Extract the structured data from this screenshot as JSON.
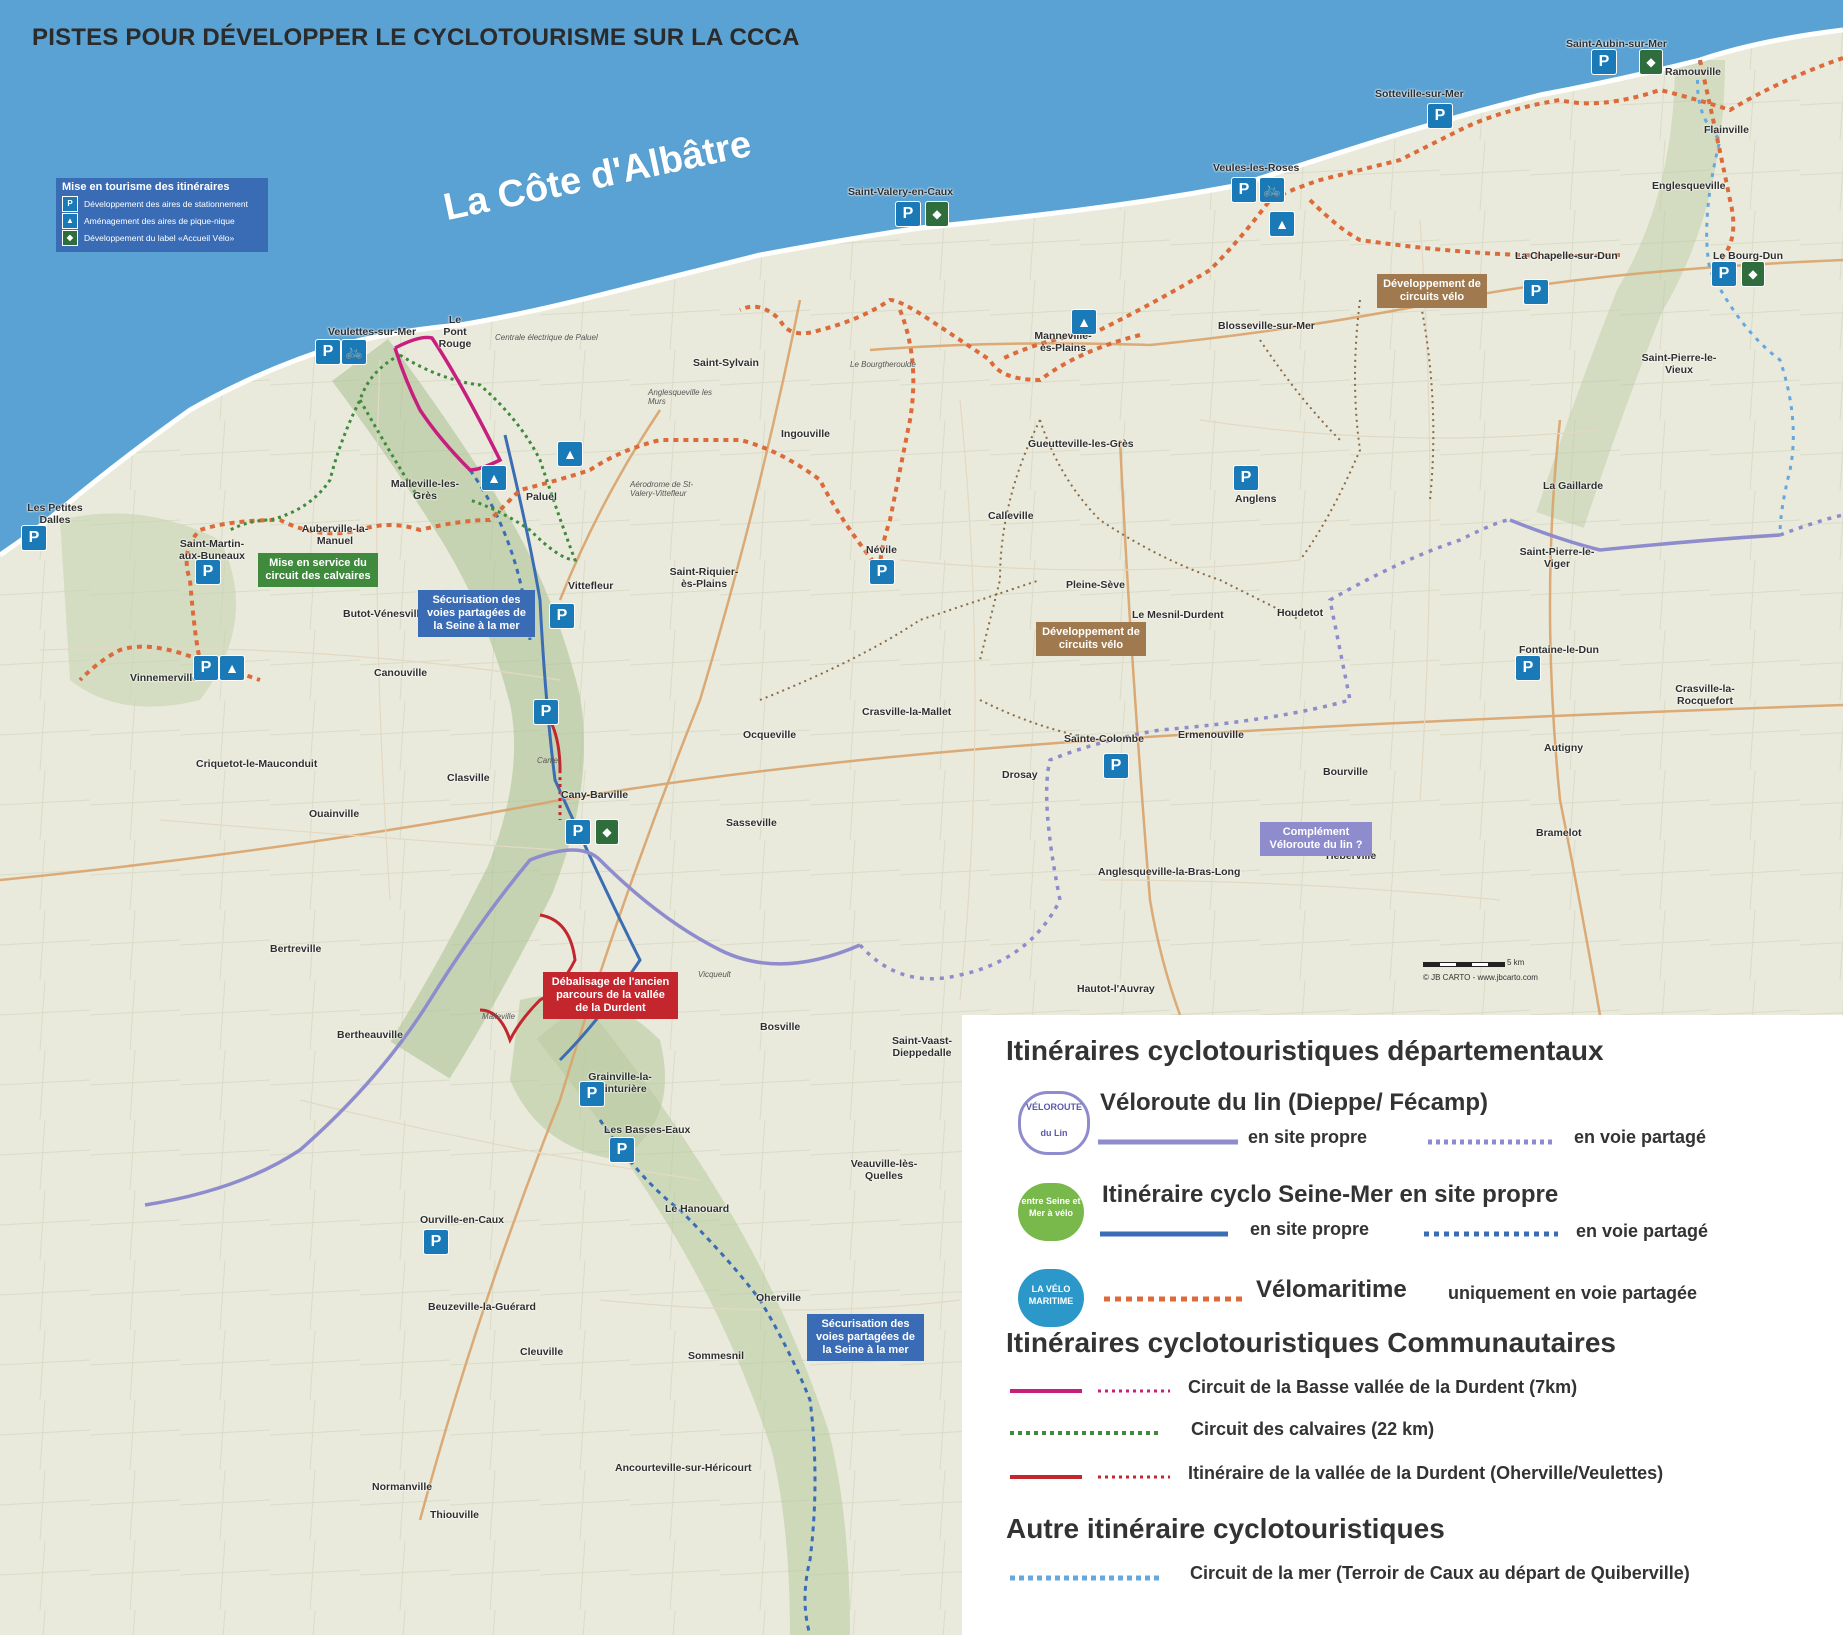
{
  "title": "PISTES POUR DÉVELOPPER LE CYCLOTOURISME SUR LA CCCA",
  "coast_label": "La Côte d'Albâtre",
  "colors": {
    "sea": "#5aa2d3",
    "land": "#e9eadb",
    "veloroute_lin": "#8e8ccd",
    "seine_mer": "#3b6db5",
    "velomaritime": "#dc6a3a",
    "basse_vallee": "#c71f7d",
    "calvaires": "#3f8a3c",
    "vallee_durdent": "#c4262e",
    "circuit_mer": "#66a8dd",
    "circuits_velo": "#8b6a46",
    "parking": "#1a7ab8",
    "accueil_velo": "#2f6e3c"
  },
  "tourism_box": {
    "heading": "Mise en tourisme des itinéraires",
    "items": [
      {
        "icon": "parking-bike-icon",
        "label": "Développement des aires de stationnement"
      },
      {
        "icon": "picnic-icon",
        "label": "Aménagement des aires de pique-nique"
      },
      {
        "icon": "accueil-velo-icon",
        "label": "Développement du label «Accueil Vélo»"
      }
    ]
  },
  "towns": [
    "Saint-Aubin-sur-Mer",
    "Ramouville",
    "Sotteville-sur-Mer",
    "Flainville",
    "Veules-les-Roses",
    "Englesqueville",
    "Saint-Valery-en-Caux",
    "La Chapelle-sur-Dun",
    "Le Bourg-Dun",
    "Veulettes-sur-Mer",
    "Le Pont Rouge",
    "Blosseville-sur-Mer",
    "Manneville-ès-Plains",
    "Saint-Pierre-le-Vieux",
    "Saint-Sylvain",
    "Anglesqueville les Murs",
    "Ingouville",
    "Le Bourgtheroulde",
    "Gueutteville-les-Grès",
    "Malleville-les-Grès",
    "Paluel",
    "Anglens",
    "La Gaillarde",
    "Les Petites Dalles",
    "Auberville-la-Manuel",
    "Saint-Martin-aux-Buneaux",
    "Calleville",
    "Névile",
    "Saint-Pierre-le-Viger",
    "Vittefleur",
    "Saint-Riquier-ès-Plains",
    "Pleine-Sève",
    "Butot-Vénesville",
    "Le Mesnil-Durdent",
    "Houdetot",
    "Vinnemerville",
    "Canouville",
    "Fontaine-le-Dun",
    "Crasville-la-Mallet",
    "Ocqueville",
    "Sainte-Colombe",
    "Ermenouville",
    "Crasville-la-Rocquefort",
    "Drosay",
    "Autigny",
    "Criquetot-le-Mauconduit",
    "Clasville",
    "Canlet",
    "Bourville",
    "Ouainville",
    "Cany-Barville",
    "Sasseville",
    "Bramelot",
    "Anglesqueville-la-Bras-Long",
    "Héberville",
    "Bertreville",
    "Hautot-l'Auvray",
    "Bertheauville",
    "Malleville",
    "Vicqueult",
    "Bosville",
    "Saint-Vaast-Dieppedalle",
    "Grainville-la-Teinturière",
    "Les Basses-Eaux",
    "Veauville-lès-Quelles",
    "Le Hanouard",
    "Ourville-en-Caux",
    "Oherville",
    "Beuzeville-la-Guérard",
    "Cleuville",
    "Sommesnil",
    "Ancourteville-sur-Héricourt",
    "Normanville",
    "Thiouville"
  ],
  "notes": {
    "calvaires": "Mise en service du circuit des calvaires",
    "seine_mer_top": "Sécurisation des voies partagées de la Seine à la mer",
    "circuits_velo_1": "Développement de circuits vélo",
    "circuits_velo_2": "Développement de circuits vélo",
    "complement": "Complément Véloroute du lin ?",
    "debalisage": "Débalisage de l'ancien parcours de la vallée de la Durdent",
    "seine_mer_bottom": "Sécurisation des voies partagées de la Seine à la mer"
  },
  "other_labels": {
    "centrale": "Centrale électrique de Paluel",
    "aerodrome": "Aérodrome de St-Valery-Vittefleur",
    "scale": "5 km",
    "credit": "© JB CARTO - www.jbcarto.com"
  },
  "legend": {
    "dept_heading": "Itinéraires cyclotouristiques départementaux",
    "veloroute": {
      "name": "Véloroute du lin (Dieppe/ Fécamp)",
      "logo_text": "VÉLOROUTE du Lin",
      "site_propre": "en site propre",
      "voie_partagee": "en voie partagé"
    },
    "seine_mer": {
      "name": "Itinéraire cyclo Seine-Mer en site propre",
      "logo_text": "entre Seine et Mer à vélo",
      "site_propre": "en site propre",
      "voie_partagee": "en voie partagé"
    },
    "velomaritime": {
      "name": "Vélomaritime",
      "qualifier": "uniquement en voie partagée",
      "logo_text": "LA VÉLO MARITIME"
    },
    "comm_heading": "Itinéraires cyclotouristiques Communautaires",
    "basse_vallee": "Circuit de la Basse vallée de la Durdent (7km)",
    "calvaires": "Circuit des calvaires (22 km)",
    "vallee_durdent": "Itinéraire de la vallée de la Durdent (Oherville/Veulettes)",
    "other_heading": "Autre itinéraire cyclotouristiques",
    "circuit_mer": "Circuit de la mer (Terroir de Caux au départ de Quiberville)"
  }
}
